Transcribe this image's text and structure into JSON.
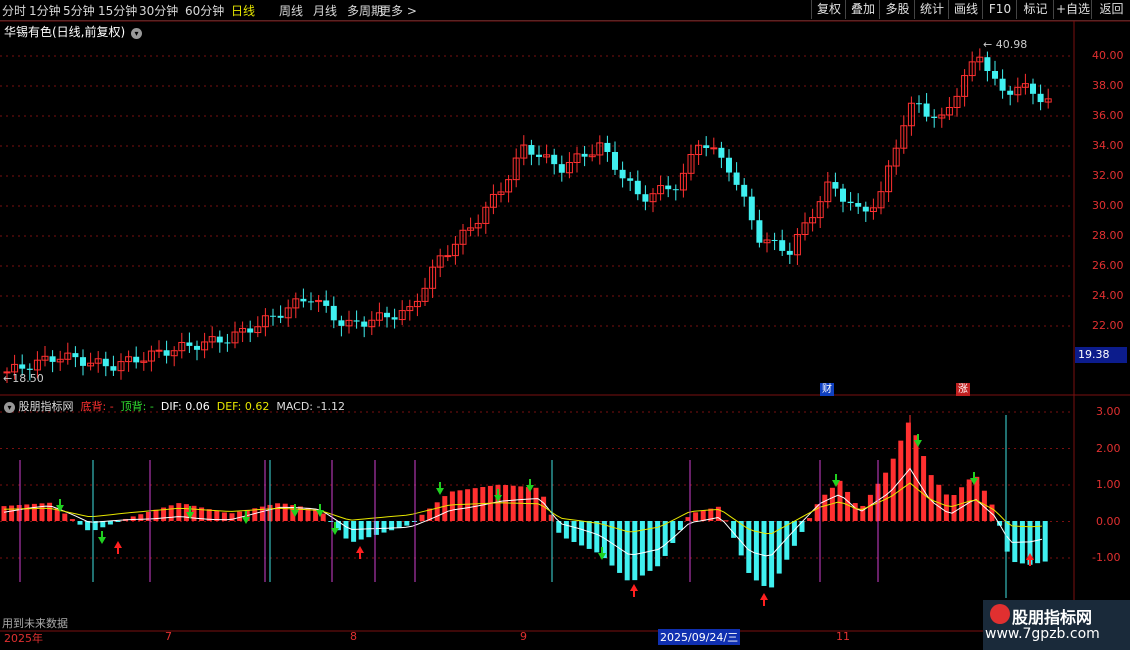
{
  "toolbar": {
    "periods": [
      "分时",
      "1分钟",
      "5分钟",
      "15分钟",
      "30分钟",
      "60分钟",
      "日线",
      "周线",
      "月线",
      "多周期",
      "更多 >"
    ],
    "active_period": "日线",
    "right_buttons": [
      "复权",
      "叠加",
      "多股",
      "统计",
      "画线",
      "F10",
      "标记",
      "+自选",
      "返回"
    ]
  },
  "stock": {
    "title": "华锡有色(日线,前复权)",
    "high_label": "40.98",
    "low_label": "18.50",
    "last_price": "19.38"
  },
  "price_axis": [
    "40.00",
    "38.00",
    "36.00",
    "34.00",
    "32.00",
    "30.00",
    "28.00",
    "26.00",
    "24.00",
    "22.00"
  ],
  "badges": {
    "cai": "财",
    "zhang": "涨"
  },
  "indicator": {
    "name": "股朋指标网",
    "bottom_label": "底背: -",
    "top_label": "顶背: -",
    "dif": "DIF: 0.06",
    "def": "DEF: 0.62",
    "macd": "MACD: -1.12",
    "axis": [
      "3.00",
      "2.00",
      "1.00",
      "0.00",
      "-1.00"
    ]
  },
  "footer_note": "用到未来数据",
  "x_axis": {
    "labels": [
      "2025年",
      "7",
      "8",
      "9",
      "11"
    ],
    "selected": "2025/09/24/三"
  },
  "watermark": {
    "name": "股朋指标网",
    "url": "www.7gpzb.com"
  },
  "colors": {
    "up": "#ff3030",
    "down": "#40f0f0",
    "dif": "#ffffff",
    "def": "#e6e600",
    "grid": "#7a1010"
  }
}
